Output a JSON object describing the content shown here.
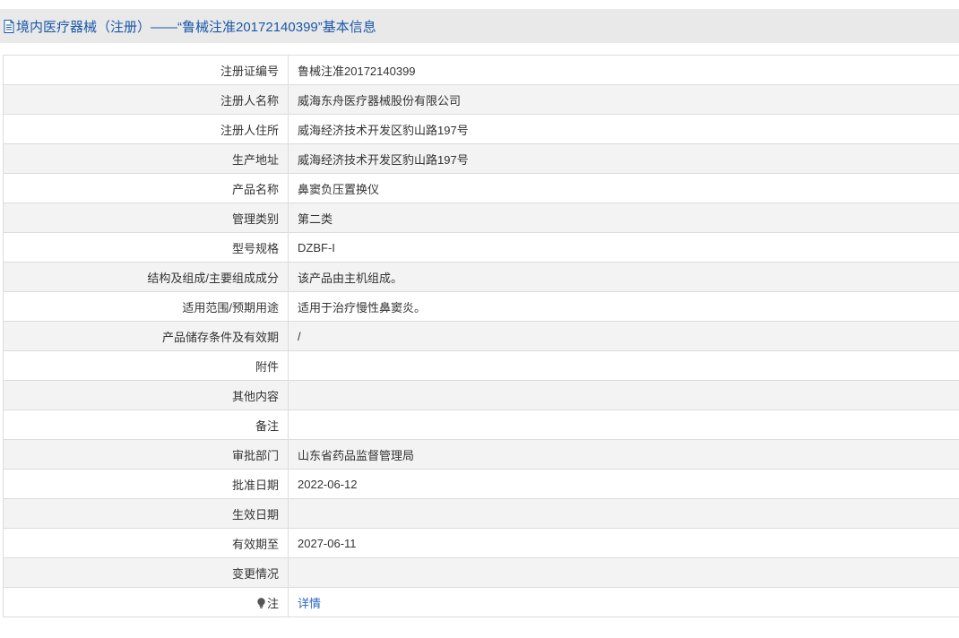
{
  "header": {
    "title": "境内医疗器械（注册）——“鲁械注准20172140399”基本信息",
    "icon": "document-icon"
  },
  "rows": [
    {
      "label": "注册证编号",
      "value": "鲁械注准20172140399"
    },
    {
      "label": "注册人名称",
      "value": "威海东舟医疗器械股份有限公司"
    },
    {
      "label": "注册人住所",
      "value": "威海经济技术开发区豹山路197号"
    },
    {
      "label": "生产地址",
      "value": "威海经济技术开发区豹山路197号"
    },
    {
      "label": "产品名称",
      "value": "鼻窦负压置换仪"
    },
    {
      "label": "管理类别",
      "value": "第二类"
    },
    {
      "label": "型号规格",
      "value": "DZBF-I"
    },
    {
      "label": "结构及组成/主要组成成分",
      "value": "该产品由主机组成。"
    },
    {
      "label": "适用范围/预期用途",
      "value": "适用于治疗慢性鼻窦炎。"
    },
    {
      "label": "产品储存条件及有效期",
      "value": "/"
    },
    {
      "label": "附件",
      "value": ""
    },
    {
      "label": "其他内容",
      "value": ""
    },
    {
      "label": "备注",
      "value": ""
    },
    {
      "label": "审批部门",
      "value": "山东省药品监督管理局"
    },
    {
      "label": "批准日期",
      "value": "2022-06-12"
    },
    {
      "label": "生效日期",
      "value": ""
    },
    {
      "label": "有效期至",
      "value": "2027-06-11"
    },
    {
      "label": "变更情况",
      "value": ""
    }
  ],
  "note_row": {
    "label": "注",
    "icon": "lightbulb-icon",
    "link_text": "详情"
  },
  "colors": {
    "title_text": "#1a58a8",
    "title_bg": "#e9e9e9",
    "row_alt_bg": "#f3f3f3",
    "border": "#dcdcdc",
    "link": "#2a66c1"
  }
}
